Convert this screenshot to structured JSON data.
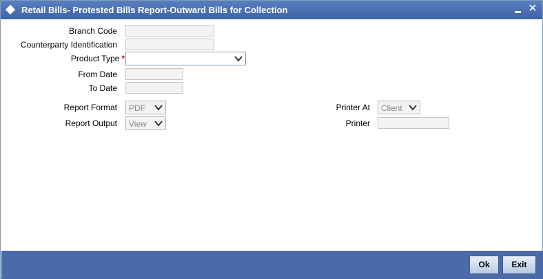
{
  "window": {
    "title": "Retail Bills- Protested Bills Report-Outward Bills for Collection",
    "minimize_symbol": "",
    "close_symbol": "✕"
  },
  "form": {
    "branch_code": {
      "label": "Branch Code",
      "value": ""
    },
    "counterparty": {
      "label": "Counterparty Identification",
      "value": ""
    },
    "product_type": {
      "label": "Product Type",
      "required_mark": "*",
      "value": ""
    },
    "from_date": {
      "label": "From Date",
      "value": ""
    },
    "to_date": {
      "label": "To Date",
      "value": ""
    },
    "report_format": {
      "label": "Report Format",
      "value": "PDF"
    },
    "report_output": {
      "label": "Report Output",
      "value": "View"
    },
    "printer_at": {
      "label": "Printer At",
      "value": "Client"
    },
    "printer": {
      "label": "Printer",
      "value": ""
    }
  },
  "footer": {
    "ok_label": "Ok",
    "exit_label": "Exit"
  },
  "colors": {
    "titlebar": "#3d64a8",
    "footer": "#4a6aa8",
    "required": "#c00000"
  }
}
